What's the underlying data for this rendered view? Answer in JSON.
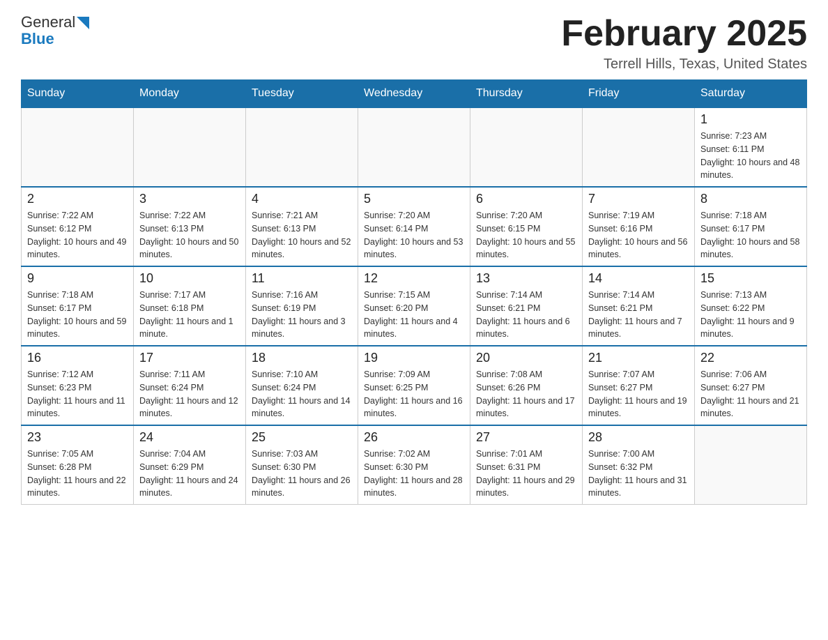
{
  "header": {
    "logo_general": "General",
    "logo_blue": "Blue",
    "title": "February 2025",
    "subtitle": "Terrell Hills, Texas, United States"
  },
  "weekdays": [
    "Sunday",
    "Monday",
    "Tuesday",
    "Wednesday",
    "Thursday",
    "Friday",
    "Saturday"
  ],
  "weeks": [
    [
      {
        "day": "",
        "info": ""
      },
      {
        "day": "",
        "info": ""
      },
      {
        "day": "",
        "info": ""
      },
      {
        "day": "",
        "info": ""
      },
      {
        "day": "",
        "info": ""
      },
      {
        "day": "",
        "info": ""
      },
      {
        "day": "1",
        "info": "Sunrise: 7:23 AM\nSunset: 6:11 PM\nDaylight: 10 hours and 48 minutes."
      }
    ],
    [
      {
        "day": "2",
        "info": "Sunrise: 7:22 AM\nSunset: 6:12 PM\nDaylight: 10 hours and 49 minutes."
      },
      {
        "day": "3",
        "info": "Sunrise: 7:22 AM\nSunset: 6:13 PM\nDaylight: 10 hours and 50 minutes."
      },
      {
        "day": "4",
        "info": "Sunrise: 7:21 AM\nSunset: 6:13 PM\nDaylight: 10 hours and 52 minutes."
      },
      {
        "day": "5",
        "info": "Sunrise: 7:20 AM\nSunset: 6:14 PM\nDaylight: 10 hours and 53 minutes."
      },
      {
        "day": "6",
        "info": "Sunrise: 7:20 AM\nSunset: 6:15 PM\nDaylight: 10 hours and 55 minutes."
      },
      {
        "day": "7",
        "info": "Sunrise: 7:19 AM\nSunset: 6:16 PM\nDaylight: 10 hours and 56 minutes."
      },
      {
        "day": "8",
        "info": "Sunrise: 7:18 AM\nSunset: 6:17 PM\nDaylight: 10 hours and 58 minutes."
      }
    ],
    [
      {
        "day": "9",
        "info": "Sunrise: 7:18 AM\nSunset: 6:17 PM\nDaylight: 10 hours and 59 minutes."
      },
      {
        "day": "10",
        "info": "Sunrise: 7:17 AM\nSunset: 6:18 PM\nDaylight: 11 hours and 1 minute."
      },
      {
        "day": "11",
        "info": "Sunrise: 7:16 AM\nSunset: 6:19 PM\nDaylight: 11 hours and 3 minutes."
      },
      {
        "day": "12",
        "info": "Sunrise: 7:15 AM\nSunset: 6:20 PM\nDaylight: 11 hours and 4 minutes."
      },
      {
        "day": "13",
        "info": "Sunrise: 7:14 AM\nSunset: 6:21 PM\nDaylight: 11 hours and 6 minutes."
      },
      {
        "day": "14",
        "info": "Sunrise: 7:14 AM\nSunset: 6:21 PM\nDaylight: 11 hours and 7 minutes."
      },
      {
        "day": "15",
        "info": "Sunrise: 7:13 AM\nSunset: 6:22 PM\nDaylight: 11 hours and 9 minutes."
      }
    ],
    [
      {
        "day": "16",
        "info": "Sunrise: 7:12 AM\nSunset: 6:23 PM\nDaylight: 11 hours and 11 minutes."
      },
      {
        "day": "17",
        "info": "Sunrise: 7:11 AM\nSunset: 6:24 PM\nDaylight: 11 hours and 12 minutes."
      },
      {
        "day": "18",
        "info": "Sunrise: 7:10 AM\nSunset: 6:24 PM\nDaylight: 11 hours and 14 minutes."
      },
      {
        "day": "19",
        "info": "Sunrise: 7:09 AM\nSunset: 6:25 PM\nDaylight: 11 hours and 16 minutes."
      },
      {
        "day": "20",
        "info": "Sunrise: 7:08 AM\nSunset: 6:26 PM\nDaylight: 11 hours and 17 minutes."
      },
      {
        "day": "21",
        "info": "Sunrise: 7:07 AM\nSunset: 6:27 PM\nDaylight: 11 hours and 19 minutes."
      },
      {
        "day": "22",
        "info": "Sunrise: 7:06 AM\nSunset: 6:27 PM\nDaylight: 11 hours and 21 minutes."
      }
    ],
    [
      {
        "day": "23",
        "info": "Sunrise: 7:05 AM\nSunset: 6:28 PM\nDaylight: 11 hours and 22 minutes."
      },
      {
        "day": "24",
        "info": "Sunrise: 7:04 AM\nSunset: 6:29 PM\nDaylight: 11 hours and 24 minutes."
      },
      {
        "day": "25",
        "info": "Sunrise: 7:03 AM\nSunset: 6:30 PM\nDaylight: 11 hours and 26 minutes."
      },
      {
        "day": "26",
        "info": "Sunrise: 7:02 AM\nSunset: 6:30 PM\nDaylight: 11 hours and 28 minutes."
      },
      {
        "day": "27",
        "info": "Sunrise: 7:01 AM\nSunset: 6:31 PM\nDaylight: 11 hours and 29 minutes."
      },
      {
        "day": "28",
        "info": "Sunrise: 7:00 AM\nSunset: 6:32 PM\nDaylight: 11 hours and 31 minutes."
      },
      {
        "day": "",
        "info": ""
      }
    ]
  ]
}
